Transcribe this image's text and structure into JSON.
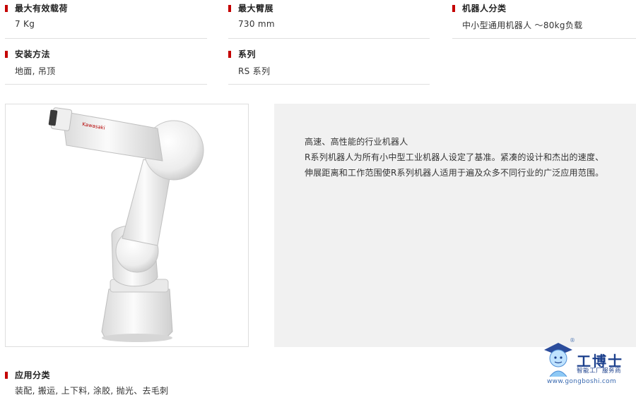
{
  "specs": {
    "payload": {
      "label": "最大有效载荷",
      "value": "7 Kg"
    },
    "reach": {
      "label": "最大臂展",
      "value": "730 mm"
    },
    "category": {
      "label": "机器人分类",
      "value": "中小型通用机器人 ～80kg负载"
    },
    "mounting": {
      "label": "安装方法",
      "value": "地面, 吊顶"
    },
    "series": {
      "label": "系列",
      "value": "RS 系列"
    },
    "application": {
      "label": "应用分类",
      "value": "装配, 搬运, 上下料, 涂胶, 抛光、去毛刺"
    }
  },
  "description": {
    "line1": "高速、高性能的行业机器人",
    "line2": "R系列机器人为所有小中型工业机器人设定了基准。紧凑的设计和杰出的速度、",
    "line3": "伸展距离和工作范围使R系列机器人适用于遍及众多不同行业的广泛应用范围。"
  },
  "robot_arm_brand": "Kawasaki",
  "watermark": {
    "brand": "工博士",
    "tagline": "智能工厂服务商",
    "url": "www.gongboshi.com",
    "reg": "®"
  },
  "colors": {
    "bullet": "#c40000",
    "panel": "#f1f1f1",
    "watermark": "#1b3f8c"
  }
}
